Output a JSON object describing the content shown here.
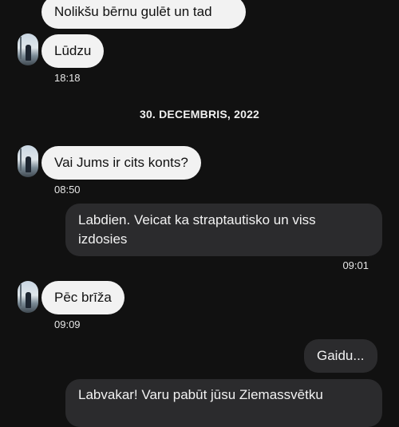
{
  "messages": [
    {
      "text": "Nolikšu bērnu gulēt un tad"
    },
    {
      "text": "Lūdzu",
      "time": "18:18"
    },
    {
      "text": "Vai Jums ir cits konts?",
      "time": "08:50"
    },
    {
      "text": "Labdien. Veicat ka straptautisko un viss izdosies",
      "time": "09:01"
    },
    {
      "text": "Pēc brīža",
      "time": "09:09"
    },
    {
      "text": "Gaidu..."
    },
    {
      "text": "Labvakar! Varu pabūt jūsu Ziemassvētku"
    }
  ],
  "date_separator": "30. DECEMBRIS, 2022"
}
